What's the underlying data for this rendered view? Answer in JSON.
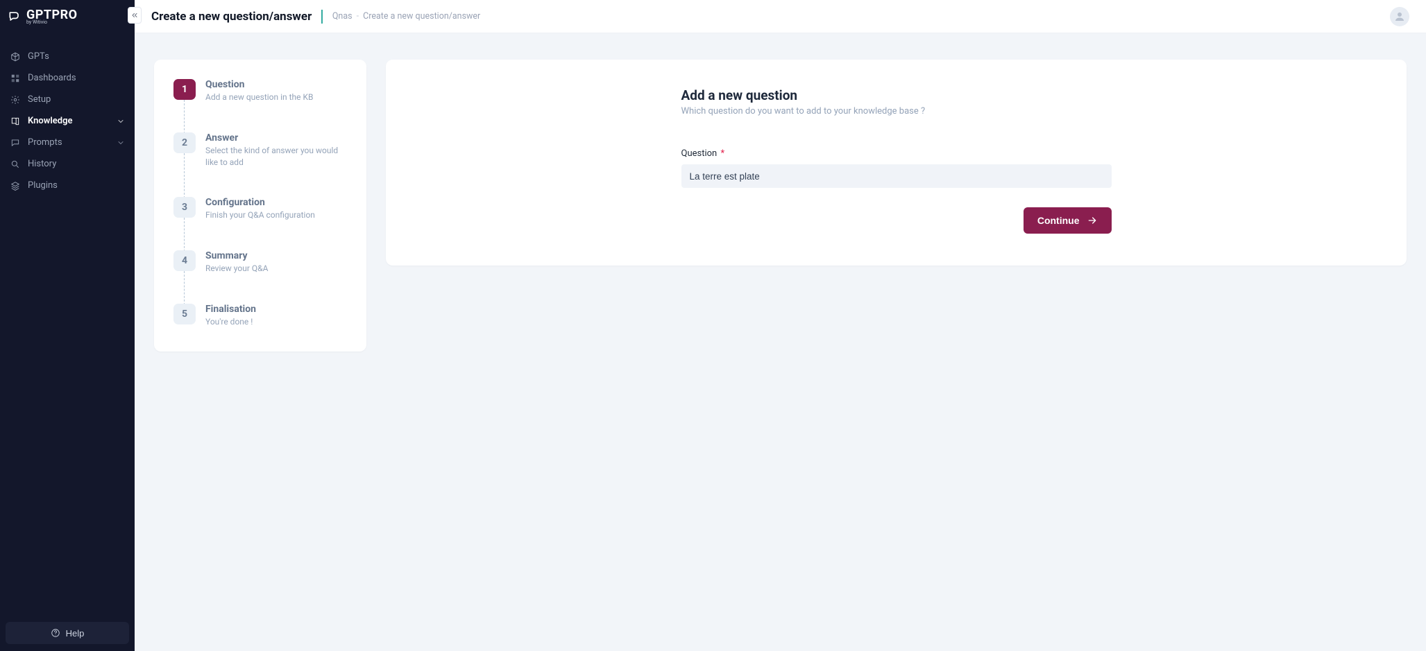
{
  "brand": {
    "name": "GPTPRO",
    "byline": "by Witivio"
  },
  "header": {
    "title": "Create a new question/answer",
    "breadcrumb": {
      "root": "Qnas",
      "current": "Create a new question/answer"
    }
  },
  "sidebar": {
    "items": [
      {
        "label": "GPTs",
        "icon": "cube",
        "expandable": false
      },
      {
        "label": "Dashboards",
        "icon": "grid",
        "expandable": false
      },
      {
        "label": "Setup",
        "icon": "gear",
        "expandable": false
      },
      {
        "label": "Knowledge",
        "icon": "book",
        "expandable": true,
        "active": true
      },
      {
        "label": "Prompts",
        "icon": "chat",
        "expandable": true
      },
      {
        "label": "History",
        "icon": "search",
        "expandable": false
      },
      {
        "label": "Plugins",
        "icon": "layers",
        "expandable": false
      }
    ],
    "help_label": "Help"
  },
  "steps": [
    {
      "title": "Question",
      "desc": "Add a new question in the KB",
      "active": true
    },
    {
      "title": "Answer",
      "desc": "Select the kind of answer you would like to add",
      "active": false
    },
    {
      "title": "Configuration",
      "desc": "Finish your Q&A configuration",
      "active": false
    },
    {
      "title": "Summary",
      "desc": "Review your Q&A",
      "active": false
    },
    {
      "title": "Finalisation",
      "desc": "You're done !",
      "active": false
    }
  ],
  "form": {
    "title": "Add a new question",
    "subtitle": "Which question do you want to add to your knowledge base ?",
    "question_label": "Question",
    "required_mark": "*",
    "question_value": "La terre est plate",
    "continue_label": "Continue"
  }
}
